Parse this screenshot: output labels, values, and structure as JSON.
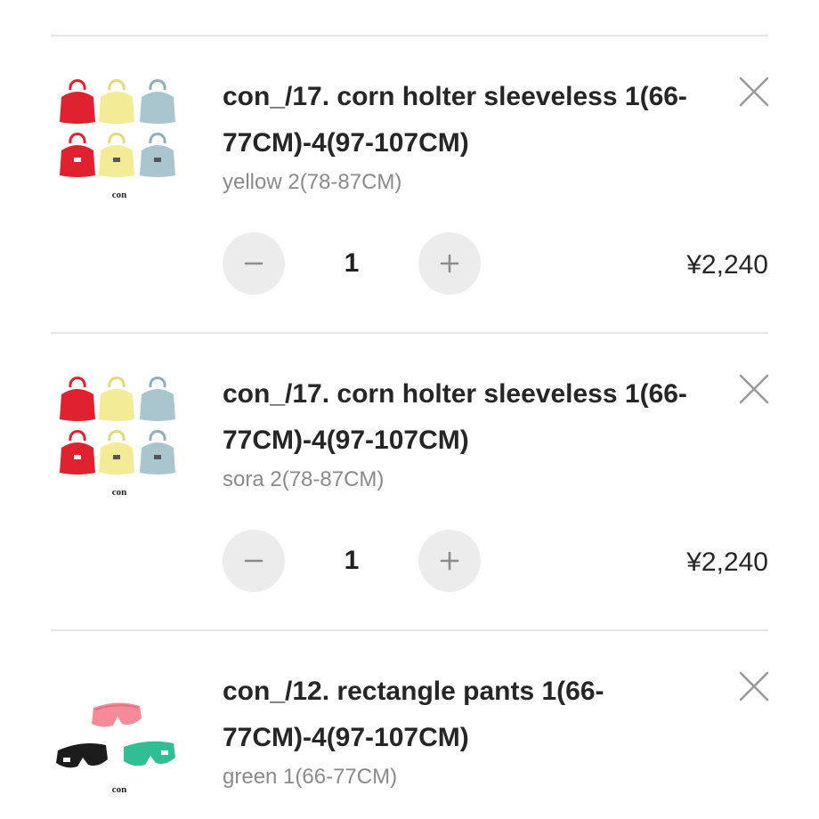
{
  "cart": {
    "items": [
      {
        "title": "con_/17. corn holter sleeveless 1(66-77CM)-4(97-107CM)",
        "variant": "yellow 2(78-87CM)",
        "quantity": "1",
        "price": "¥2,240",
        "thumbnail_label": "con",
        "thumbnail_icon": "halter-tops-thumbnail-icon"
      },
      {
        "title": "con_/17. corn holter sleeveless 1(66-77CM)-4(97-107CM)",
        "variant": "sora 2(78-87CM)",
        "quantity": "1",
        "price": "¥2,240",
        "thumbnail_label": "con",
        "thumbnail_icon": "halter-tops-thumbnail-icon"
      },
      {
        "title": "con_/12. rectangle pants 1(66-77CM)-4(97-107CM)",
        "variant": "green 1(66-77CM)",
        "thumbnail_label": "con",
        "thumbnail_icon": "shorts-thumbnail-icon"
      }
    ],
    "icons": {
      "remove": "close-icon",
      "decrease": "minus-icon",
      "increase": "plus-icon"
    },
    "colors": {
      "top_red": "#e0212f",
      "top_yellow": "#f3eb96",
      "top_blue": "#a9c6cf",
      "shorts_pink": "#f58a98",
      "shorts_black": "#1c1c1c",
      "shorts_green": "#2fbf92",
      "button_bg": "#ececec",
      "divider": "#e6e6e6",
      "variant_text": "#8a8a8a"
    }
  }
}
